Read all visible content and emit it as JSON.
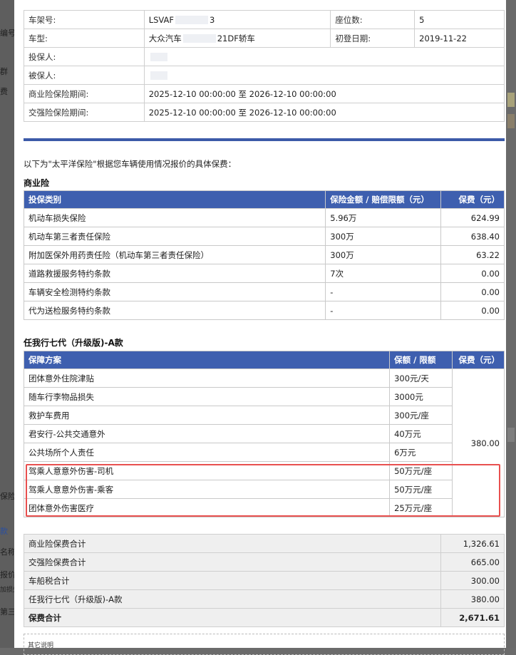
{
  "left_cutoff": [
    "编号",
    "群",
    "费",
    "保险",
    "款",
    "名称",
    "报价损失",
    "加损失",
    "第三"
  ],
  "vehicle_info": {
    "rows": [
      {
        "label": "车架号:",
        "value": "LSVAF",
        "value_tail": "3",
        "label2": "座位数:",
        "value2": "5"
      },
      {
        "label": "车型:",
        "value": "大众汽车",
        "value_tail": "21DF轿车",
        "label2": "初登日期:",
        "value2": "2019-11-22"
      },
      {
        "label": "投保人:",
        "value": "",
        "value_tail": "",
        "label2": "",
        "value2": ""
      },
      {
        "label": "被保人:",
        "value": "",
        "value_tail": "",
        "label2": "",
        "value2": ""
      },
      {
        "label": "商业险保险期间:",
        "value": "2025-12-10 00:00:00 至 2026-12-10 00:00:00",
        "value_tail": "",
        "label2": "",
        "value2": ""
      },
      {
        "label": "交强险保险期间:",
        "value": "2025-12-10 00:00:00 至 2026-12-10 00:00:00",
        "value_tail": "",
        "label2": "",
        "value2": ""
      }
    ]
  },
  "intro": "以下为\"太平洋保险\"根据您车辆使用情况报价的具体保费：",
  "commercial": {
    "title": "商业险",
    "headers": [
      "投保类别",
      "保险金额 / 赔偿限额（元）",
      "保费（元）"
    ],
    "rows": [
      [
        "机动车损失保险",
        "5.96万",
        "624.99"
      ],
      [
        "机动车第三者责任保险",
        "300万",
        "638.40"
      ],
      [
        "附加医保外用药责任险（机动车第三者责任保险）",
        "300万",
        "63.22"
      ],
      [
        "道路救援服务特约条款",
        "7次",
        "0.00"
      ],
      [
        "车辆安全检测特约条款",
        "-",
        "0.00"
      ],
      [
        "代为送检服务特约条款",
        "-",
        "0.00"
      ]
    ]
  },
  "plan": {
    "title": "任我行七代（升级版)-A款",
    "headers": [
      "保障方案",
      "保额 / 限额",
      "保费（元）"
    ],
    "premium": "380.00",
    "rows": [
      [
        "团体意外住院津贴",
        "300元/天"
      ],
      [
        "随车行李物品损失",
        "3000元"
      ],
      [
        "救护车费用",
        "300元/座"
      ],
      [
        "君安行-公共交通意外",
        "40万元"
      ],
      [
        "公共场所个人责任",
        "6万元"
      ],
      [
        "驾乘人意意外伤害-司机",
        "50万元/座"
      ],
      [
        "驾乘人意意外伤害-乘客",
        "50万元/座"
      ],
      [
        "团体意外伤害医疗",
        "25万元/座"
      ]
    ]
  },
  "summary": [
    [
      "商业险保费合计",
      "1,326.61"
    ],
    [
      "交强险保费合计",
      "665.00"
    ],
    [
      "车船税合计",
      "300.00"
    ],
    [
      "任我行七代（升级版)-A款",
      "380.00"
    ],
    [
      "保费合计",
      "2,671.61"
    ]
  ],
  "other_note": "其它说明"
}
